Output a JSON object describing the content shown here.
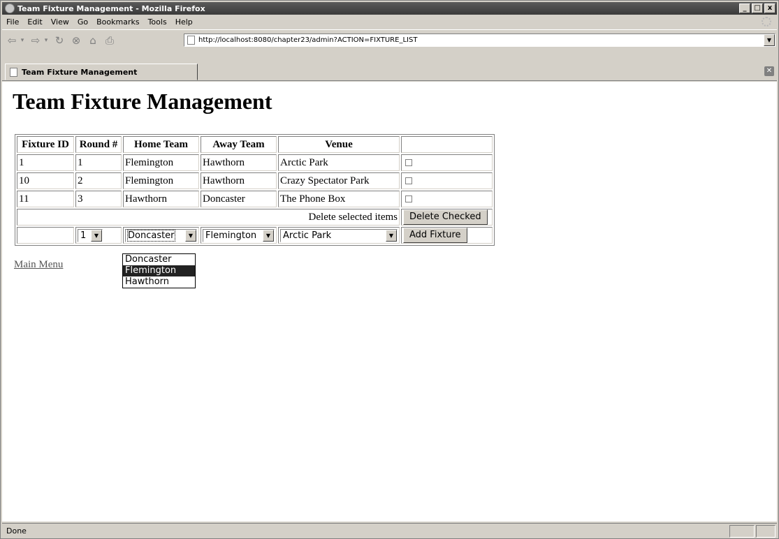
{
  "window": {
    "title": "Team Fixture Management - Mozilla Firefox",
    "minimize": "_",
    "maximize": "□",
    "close": "x"
  },
  "menubar": [
    "File",
    "Edit",
    "View",
    "Go",
    "Bookmarks",
    "Tools",
    "Help"
  ],
  "navbar": {
    "url": "http://localhost:8080/chapter23/admin?ACTION=FIXTURE_LIST"
  },
  "tab": {
    "label": "Team Fixture Management"
  },
  "page": {
    "heading": "Team Fixture Management",
    "table": {
      "headers": [
        "Fixture ID",
        "Round #",
        "Home Team",
        "Away Team",
        "Venue",
        ""
      ],
      "rows": [
        {
          "id": "1",
          "round": "1",
          "home": "Flemington",
          "away": "Hawthorn",
          "venue": "Arctic Park"
        },
        {
          "id": "10",
          "round": "2",
          "home": "Flemington",
          "away": "Hawthorn",
          "venue": "Crazy Spectator Park"
        },
        {
          "id": "11",
          "round": "3",
          "home": "Hawthorn",
          "away": "Doncaster",
          "venue": "The Phone Box"
        }
      ],
      "delete_label": "Delete selected items",
      "delete_button": "Delete Checked",
      "add_row": {
        "round": "1",
        "home": "Doncaster",
        "away": "Flemington",
        "venue": "Arctic Park",
        "add_button": "Add Fixture"
      }
    },
    "dropdown_options": [
      "Doncaster",
      "Flemington",
      "Hawthorn"
    ],
    "dropdown_highlighted": "Flemington",
    "main_menu_link": "Main Menu"
  },
  "status": {
    "text": "Done"
  }
}
